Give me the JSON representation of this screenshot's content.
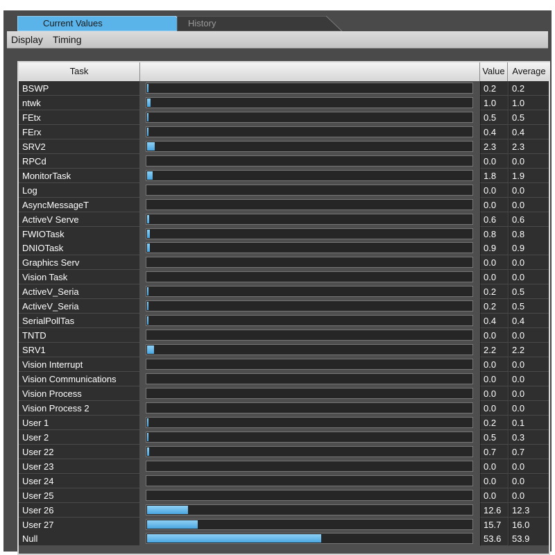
{
  "tabs": {
    "current_label": "Current Values",
    "history_label": "History"
  },
  "menu": {
    "display_label": "Display",
    "timing_label": "Timing"
  },
  "table": {
    "headers": {
      "task": "Task",
      "value": "Value",
      "average": "Average"
    },
    "bar_max": 100,
    "rows": [
      {
        "task": "BSWP",
        "value": "0.2",
        "average": "0.2"
      },
      {
        "task": "ntwk",
        "value": "1.0",
        "average": "1.0"
      },
      {
        "task": "FEtx",
        "value": "0.5",
        "average": "0.5"
      },
      {
        "task": "FErx",
        "value": "0.4",
        "average": "0.4"
      },
      {
        "task": "SRV2",
        "value": "2.3",
        "average": "2.3"
      },
      {
        "task": "RPCd",
        "value": "0.0",
        "average": "0.0"
      },
      {
        "task": "MonitorTask",
        "value": "1.8",
        "average": "1.9"
      },
      {
        "task": "Log",
        "value": "0.0",
        "average": "0.0"
      },
      {
        "task": "AsyncMessageT",
        "value": "0.0",
        "average": "0.0"
      },
      {
        "task": "ActiveV Serve",
        "value": "0.6",
        "average": "0.6"
      },
      {
        "task": "FWIOTask",
        "value": "0.8",
        "average": "0.8"
      },
      {
        "task": "DNIOTask",
        "value": "0.9",
        "average": "0.9"
      },
      {
        "task": "Graphics Serv",
        "value": "0.0",
        "average": "0.0"
      },
      {
        "task": "Vision Task",
        "value": "0.0",
        "average": "0.0"
      },
      {
        "task": "ActiveV_Seria",
        "value": "0.2",
        "average": "0.5"
      },
      {
        "task": "ActiveV_Seria",
        "value": "0.2",
        "average": "0.5"
      },
      {
        "task": "SerialPollTas",
        "value": "0.4",
        "average": "0.4"
      },
      {
        "task": "TNTD",
        "value": "0.0",
        "average": "0.0"
      },
      {
        "task": "SRV1",
        "value": "2.2",
        "average": "2.2"
      },
      {
        "task": "Vision Interrupt",
        "value": "0.0",
        "average": "0.0"
      },
      {
        "task": "Vision Communications",
        "value": "0.0",
        "average": "0.0"
      },
      {
        "task": "Vision Process",
        "value": "0.0",
        "average": "0.0"
      },
      {
        "task": "Vision Process 2",
        "value": "0.0",
        "average": "0.0"
      },
      {
        "task": "User 1",
        "value": "0.2",
        "average": "0.1"
      },
      {
        "task": "User 2",
        "value": "0.5",
        "average": "0.3"
      },
      {
        "task": "User 22",
        "value": "0.7",
        "average": "0.7"
      },
      {
        "task": "User 23",
        "value": "0.0",
        "average": "0.0"
      },
      {
        "task": "User 24",
        "value": "0.0",
        "average": "0.0"
      },
      {
        "task": "User 25",
        "value": "0.0",
        "average": "0.0"
      },
      {
        "task": "User 26",
        "value": "12.6",
        "average": "12.3"
      },
      {
        "task": "User 27",
        "value": "15.7",
        "average": "16.0"
      },
      {
        "task": "Null",
        "value": "53.6",
        "average": "53.9"
      }
    ]
  },
  "colors": {
    "bar_fill": "#5ab4ea",
    "active_tab": "#5ab4ea",
    "row_bg": "#2f2f2f"
  }
}
